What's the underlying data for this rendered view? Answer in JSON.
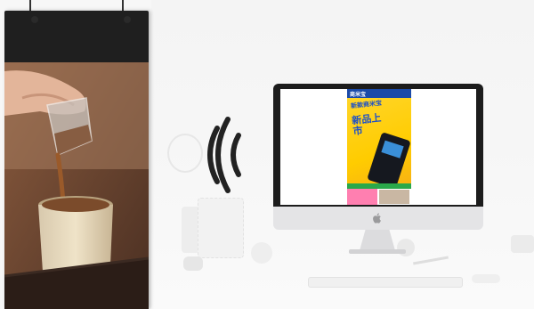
{
  "scene": {
    "poster": {
      "orientation": "portrait",
      "image": "coffee-pour-photo"
    },
    "signal": {
      "icon": "wireless-signal-icon"
    },
    "monitor": {
      "logo": "apple-icon"
    },
    "flyer": {
      "brand": "商米宝",
      "headline": "新款商米宝",
      "sub": "新品上市"
    },
    "colors": {
      "poster_frame": "#1f1f1f",
      "flyer_yellow": "#ffcc00",
      "flyer_blue": "#1d50c8",
      "flyer_green": "#2aa84a",
      "flyer_pink": "#ff7fb0"
    }
  }
}
